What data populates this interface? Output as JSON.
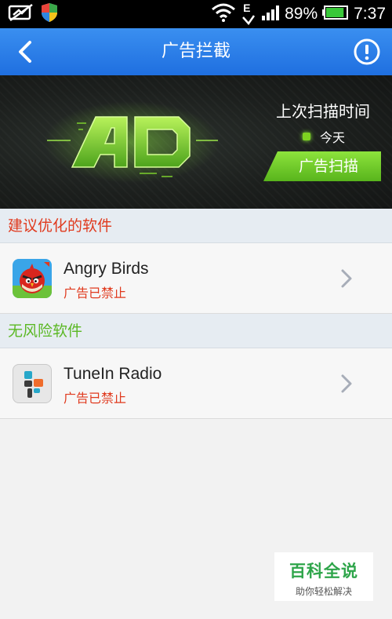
{
  "status_bar": {
    "battery_percent": "89%",
    "time": "7:37",
    "network": "E",
    "icons": [
      "no-signal-icon",
      "shield-icon",
      "wifi-icon",
      "network-arrows-icon",
      "signal-icon",
      "battery-icon"
    ],
    "battery_level": 0.89
  },
  "nav": {
    "title": "广告拦截",
    "back_icon": "back-icon",
    "info_icon": "info-icon"
  },
  "banner": {
    "logo_text": "AD",
    "last_scan_label": "上次扫描时间",
    "last_scan_value": "今天",
    "scan_button_label": "广告扫描"
  },
  "sections": [
    {
      "title": "建议优化的软件",
      "color": "#e03a1e",
      "apps": [
        {
          "name": "Angry Birds",
          "status": "广告已禁止",
          "icon": "angry-birds-icon"
        }
      ]
    },
    {
      "title": "无风险软件",
      "color": "#5bb824",
      "apps": [
        {
          "name": "TuneIn Radio",
          "status": "广告已禁止",
          "icon": "tunein-radio-icon"
        }
      ]
    }
  ],
  "watermark": {
    "title": "百科全说",
    "subtitle": "助你轻松解决"
  },
  "colors": {
    "nav_blue": "#2a7fe8",
    "accent_green": "#7ed321",
    "warning_red": "#e03a1e"
  }
}
